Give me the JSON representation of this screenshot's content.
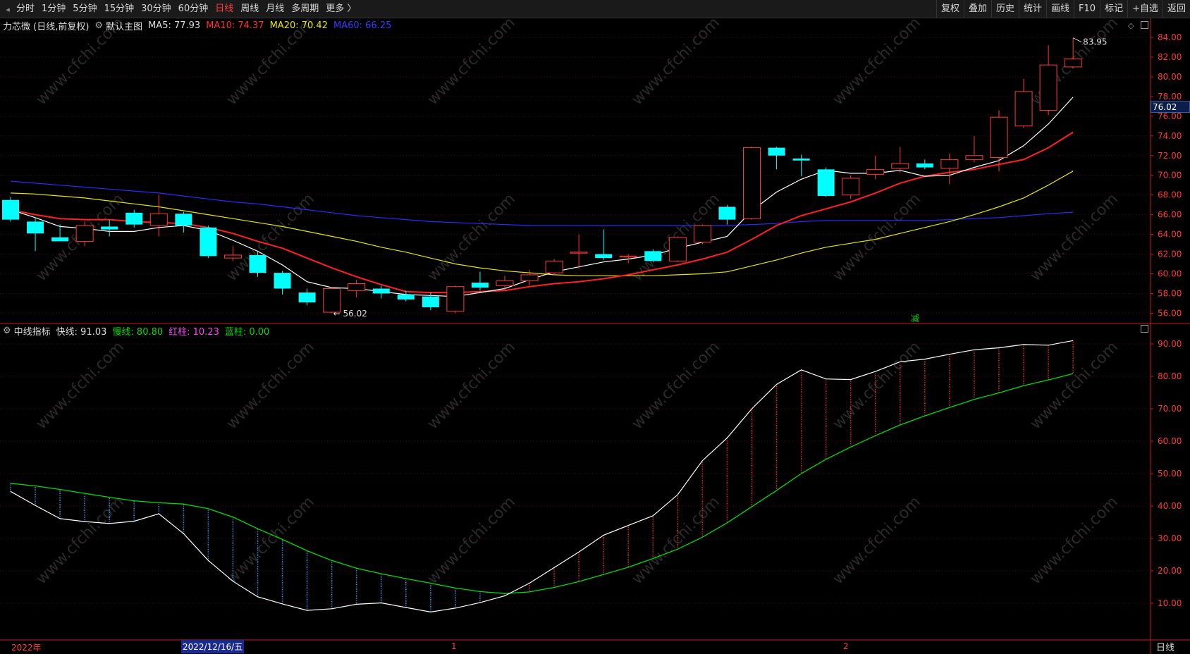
{
  "toolbar": {
    "items": [
      "分时",
      "1分钟",
      "5分钟",
      "15分钟",
      "30分钟",
      "60分钟",
      "日线",
      "周线",
      "月线",
      "多周期",
      "更多 〉"
    ],
    "active_index": 6,
    "right_buttons": [
      "复权",
      "叠加",
      "历史",
      "统计",
      "画线",
      "F10",
      "标记",
      "+自选",
      "返回"
    ]
  },
  "main_info": {
    "stock": "力芯微 (日线,前复权)",
    "indicator_name": "默认主图",
    "ma5": "MA5: 77.93",
    "ma10": "MA10: 74.37",
    "ma20": "MA20: 70.42",
    "ma60": "MA60: 66.25"
  },
  "sub_info": {
    "name": "中线指标",
    "fast": "快线: 91.03",
    "slow": "慢线: 80.80",
    "red": "红柱: 10.23",
    "blue": "蓝柱: 0.00"
  },
  "colors": {
    "up": "#ff3b3b",
    "down": "#00ffff",
    "ma5": "#ffffff",
    "ma10": "#ff2020",
    "ma20": "#e6e600",
    "ma60": "#2a2aff",
    "slow": "#00dd00",
    "grid": "#5a0000"
  },
  "price_axis": [
    "84.00",
    "82.00",
    "80.00",
    "78.00",
    "76.00",
    "74.00",
    "72.00",
    "70.00",
    "68.00",
    "66.00",
    "64.00",
    "62.00",
    "60.00",
    "58.00",
    "56.00"
  ],
  "sub_axis": [
    "90.00",
    "80.00",
    "70.00",
    "60.00",
    "50.00",
    "40.00",
    "30.00",
    "20.00",
    "10.00"
  ],
  "last_price": "76.02",
  "high_label": "83.95",
  "low_label": "56.02",
  "marker_char": "减",
  "dates": {
    "year": "2022年",
    "cursor": "2022/12/16/五",
    "m1": "1",
    "m2": "2"
  },
  "period_label": "日线",
  "watermark": "www.cfchi.com",
  "chart_data": {
    "type": "candlestick",
    "candles": [
      {
        "o": 67.5,
        "h": 67.8,
        "l": 65.3,
        "c": 65.5
      },
      {
        "o": 65.3,
        "h": 65.7,
        "l": 62.3,
        "c": 64.1
      },
      {
        "o": 63.7,
        "h": 65.0,
        "l": 63.3,
        "c": 63.3
      },
      {
        "o": 63.3,
        "h": 65.3,
        "l": 62.8,
        "c": 64.9
      },
      {
        "o": 64.8,
        "h": 65.5,
        "l": 63.8,
        "c": 64.5
      },
      {
        "o": 66.2,
        "h": 66.5,
        "l": 64.7,
        "c": 65.0
      },
      {
        "o": 64.9,
        "h": 68.0,
        "l": 63.8,
        "c": 66.1
      },
      {
        "o": 66.1,
        "h": 66.3,
        "l": 64.2,
        "c": 64.9
      },
      {
        "o": 64.7,
        "h": 64.9,
        "l": 61.6,
        "c": 61.8
      },
      {
        "o": 61.6,
        "h": 62.8,
        "l": 61.3,
        "c": 61.9
      },
      {
        "o": 61.9,
        "h": 62.3,
        "l": 59.7,
        "c": 60.1
      },
      {
        "o": 60.1,
        "h": 60.3,
        "l": 57.9,
        "c": 58.5
      },
      {
        "o": 58.1,
        "h": 58.5,
        "l": 56.8,
        "c": 57.1
      },
      {
        "o": 56.1,
        "h": 58.6,
        "l": 56.02,
        "c": 58.5
      },
      {
        "o": 58.3,
        "h": 59.4,
        "l": 57.6,
        "c": 59.0
      },
      {
        "o": 58.5,
        "h": 58.8,
        "l": 57.5,
        "c": 58.0
      },
      {
        "o": 57.9,
        "h": 58.3,
        "l": 57.2,
        "c": 57.4
      },
      {
        "o": 57.7,
        "h": 58.1,
        "l": 56.3,
        "c": 56.6
      },
      {
        "o": 56.2,
        "h": 58.8,
        "l": 56.0,
        "c": 58.7
      },
      {
        "o": 59.1,
        "h": 60.2,
        "l": 58.3,
        "c": 58.6
      },
      {
        "o": 58.8,
        "h": 59.8,
        "l": 58.3,
        "c": 59.3
      },
      {
        "o": 59.3,
        "h": 60.4,
        "l": 58.8,
        "c": 59.9
      },
      {
        "o": 60.1,
        "h": 61.5,
        "l": 59.9,
        "c": 61.3
      },
      {
        "o": 62.1,
        "h": 64.0,
        "l": 60.5,
        "c": 62.2
      },
      {
        "o": 62.0,
        "h": 64.5,
        "l": 61.4,
        "c": 61.6
      },
      {
        "o": 61.7,
        "h": 62.0,
        "l": 61.1,
        "c": 61.8
      },
      {
        "o": 62.3,
        "h": 62.5,
        "l": 61.2,
        "c": 61.3
      },
      {
        "o": 61.3,
        "h": 63.8,
        "l": 61.2,
        "c": 63.7
      },
      {
        "o": 63.2,
        "h": 65.0,
        "l": 63.0,
        "c": 64.9
      },
      {
        "o": 66.8,
        "h": 67.0,
        "l": 65.0,
        "c": 65.5
      },
      {
        "o": 65.6,
        "h": 72.9,
        "l": 65.5,
        "c": 72.8
      },
      {
        "o": 72.8,
        "h": 72.9,
        "l": 70.6,
        "c": 72.0
      },
      {
        "o": 71.7,
        "h": 72.1,
        "l": 69.9,
        "c": 71.5
      },
      {
        "o": 70.6,
        "h": 70.8,
        "l": 67.8,
        "c": 67.9
      },
      {
        "o": 68.0,
        "h": 70.0,
        "l": 67.6,
        "c": 69.7
      },
      {
        "o": 70.1,
        "h": 72.0,
        "l": 69.6,
        "c": 70.6
      },
      {
        "o": 70.7,
        "h": 72.9,
        "l": 70.3,
        "c": 71.2
      },
      {
        "o": 71.2,
        "h": 71.6,
        "l": 70.6,
        "c": 70.8
      },
      {
        "o": 70.7,
        "h": 72.2,
        "l": 69.1,
        "c": 71.6
      },
      {
        "o": 71.6,
        "h": 74.0,
        "l": 71.3,
        "c": 72.0
      },
      {
        "o": 71.8,
        "h": 76.6,
        "l": 70.4,
        "c": 75.9
      },
      {
        "o": 75.0,
        "h": 79.8,
        "l": 74.8,
        "c": 78.5
      },
      {
        "o": 76.6,
        "h": 83.2,
        "l": 76.1,
        "c": 81.2
      },
      {
        "o": 81.0,
        "h": 83.95,
        "l": 80.9,
        "c": 81.8
      }
    ],
    "ma5": [
      66.5,
      65.7,
      64.8,
      64.6,
      64.3,
      64.3,
      64.7,
      64.9,
      64.4,
      63.4,
      62.3,
      60.9,
      59.2,
      58.6,
      58.5,
      58.2,
      57.9,
      57.8,
      57.7,
      58.1,
      58.5,
      59.4,
      60.2,
      60.7,
      61.2,
      61.5,
      61.9,
      62.6,
      63.2,
      63.8,
      66.4,
      68.3,
      69.6,
      70.5,
      70.2,
      70.2,
      70.5,
      69.9,
      70.0,
      70.8,
      71.5,
      73.0,
      75.2,
      77.93
    ],
    "ma10": [
      66.5,
      66.0,
      65.6,
      65.5,
      65.5,
      65.3,
      65.2,
      65.1,
      64.7,
      64.1,
      63.3,
      62.6,
      61.6,
      60.6,
      59.7,
      58.9,
      58.2,
      58.1,
      58.1,
      58.2,
      58.3,
      58.7,
      59.0,
      59.2,
      59.5,
      59.9,
      60.4,
      60.9,
      61.5,
      62.2,
      63.5,
      64.9,
      65.9,
      66.6,
      67.3,
      68.2,
      69.2,
      69.9,
      70.3,
      70.6,
      71.1,
      71.6,
      72.8,
      74.37
    ],
    "ma20": [
      68.2,
      68.1,
      67.9,
      67.7,
      67.4,
      67.1,
      66.8,
      66.4,
      66.0,
      65.6,
      65.2,
      64.8,
      64.3,
      63.8,
      63.3,
      62.7,
      62.2,
      61.6,
      61.0,
      60.6,
      60.3,
      60.1,
      59.9,
      59.8,
      59.8,
      59.8,
      59.8,
      59.9,
      60.0,
      60.2,
      60.8,
      61.4,
      62.1,
      62.7,
      63.1,
      63.5,
      64.1,
      64.7,
      65.3,
      66.0,
      66.8,
      67.7,
      69.0,
      70.42
    ],
    "ma60": [
      69.4,
      69.2,
      69.0,
      68.8,
      68.6,
      68.4,
      68.2,
      67.9,
      67.6,
      67.3,
      67.1,
      66.8,
      66.5,
      66.2,
      65.9,
      65.7,
      65.5,
      65.3,
      65.2,
      65.1,
      65.0,
      64.9,
      64.9,
      64.9,
      64.9,
      64.9,
      64.9,
      64.9,
      64.9,
      64.9,
      65.0,
      65.1,
      65.3,
      65.4,
      65.4,
      65.4,
      65.4,
      65.4,
      65.5,
      65.6,
      65.7,
      65.9,
      66.1,
      66.25
    ],
    "fast": [
      44.5,
      40.2,
      36.1,
      35.2,
      34.6,
      35.3,
      37.6,
      31.5,
      23.2,
      16.8,
      12.0,
      9.8,
      7.8,
      8.3,
      9.7,
      10.1,
      8.7,
      7.3,
      8.5,
      10.2,
      12.3,
      16.2,
      21.0,
      25.8,
      31.0,
      34.0,
      37.0,
      43.5,
      54.0,
      61.0,
      70.0,
      77.5,
      82.0,
      79.2,
      79.0,
      81.5,
      84.5,
      85.3,
      86.8,
      88.2,
      88.8,
      89.8,
      89.6,
      91.03
    ],
    "slow": [
      47.0,
      46.2,
      45.1,
      43.9,
      42.7,
      41.6,
      41.0,
      40.6,
      39.2,
      36.6,
      33.0,
      29.7,
      26.2,
      23.2,
      20.8,
      19.1,
      17.6,
      16.2,
      14.7,
      13.6,
      13.0,
      13.5,
      14.9,
      16.7,
      18.9,
      21.1,
      23.8,
      26.7,
      30.4,
      34.8,
      39.8,
      44.8,
      50.0,
      54.4,
      58.2,
      61.7,
      65.0,
      67.8,
      70.4,
      72.9,
      74.9,
      77.1,
      78.9,
      80.8
    ],
    "price_range": [
      55.0,
      85.0
    ],
    "sub_range": [
      0.0,
      95.0
    ]
  }
}
